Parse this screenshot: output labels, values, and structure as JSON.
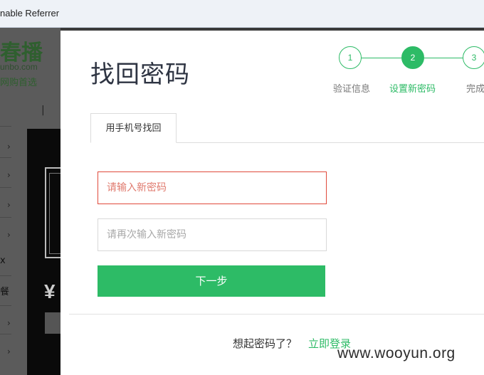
{
  "browser": {
    "title_fragment": "nable Referrer"
  },
  "background": {
    "logo": "春播",
    "domain": "unbo.com",
    "slogan": "网购首选",
    "yen": "¥",
    "side_text_1": "x",
    "side_text_2": "餐"
  },
  "modal": {
    "title": "找回密码",
    "steps": [
      {
        "number": "1",
        "label": "验证信息",
        "state": "done"
      },
      {
        "number": "2",
        "label": "设置新密码",
        "state": "active"
      },
      {
        "number": "3",
        "label": "完成",
        "state": "todo"
      }
    ],
    "tab_label": "用手机号找回",
    "new_password": {
      "placeholder": "请输入新密码",
      "state": "error"
    },
    "confirm_password": {
      "placeholder": "请再次输入新密码"
    },
    "next_button": "下一步",
    "footer": {
      "prompt": "想起密码了？",
      "login_link": "立即登录"
    }
  },
  "watermark": "www.wooyun.org",
  "colors": {
    "accent": "#2dbb66",
    "error": "#e04a3b"
  }
}
